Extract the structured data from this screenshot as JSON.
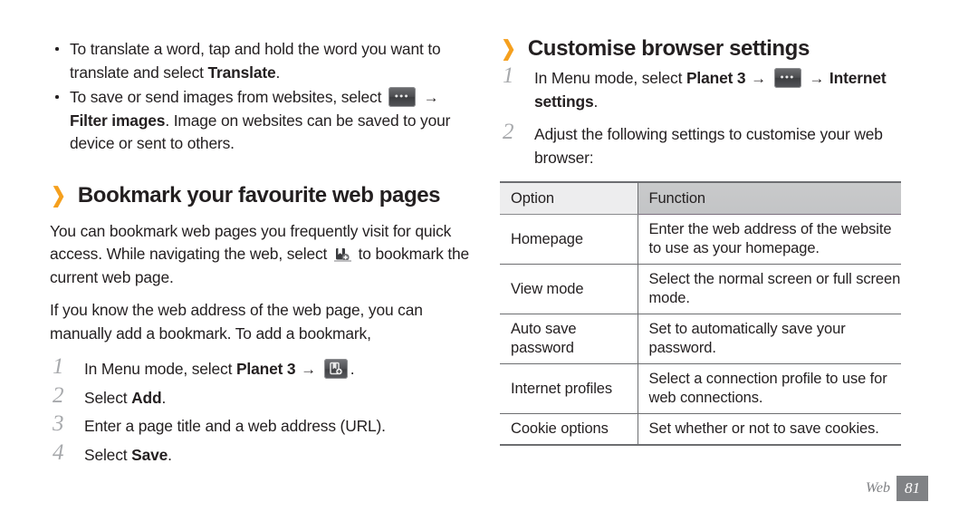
{
  "page": {
    "background": "#ffffff",
    "accent_orange": "#f5a01e",
    "text_color": "#231f20",
    "rule_color": "#6d6e71"
  },
  "left_column": {
    "bullets": [
      {
        "parts": [
          {
            "t": "To translate a word, tap and hold the word you want to translate and select ",
            "bold": false
          },
          {
            "t": "Translate",
            "bold": true
          },
          {
            "t": ".",
            "bold": false
          }
        ]
      },
      {
        "parts": [
          {
            "t": "To save or send images from websites, select ",
            "bold": false
          },
          {
            "icon": "more-options-key"
          },
          {
            "t": " ",
            "bold": false
          },
          {
            "arrow": "→"
          },
          {
            "t": " ",
            "bold": false
          },
          {
            "t": "Filter images",
            "bold": true
          },
          {
            "t": ". Image on websites can be saved to your device or sent to others.",
            "bold": false
          }
        ]
      }
    ],
    "heading": {
      "chevron": "❯",
      "text": "Bookmark your favourite web pages"
    },
    "paragraphs": [
      {
        "parts": [
          {
            "t": "You can bookmark web pages you frequently visit for quick access. While navigating the web, select ",
            "bold": false
          },
          {
            "icon": "add-bookmark-glyph"
          },
          {
            "t": " to bookmark the current web page.",
            "bold": false
          }
        ]
      },
      {
        "parts": [
          {
            "t": "If you know the web address of the web page, you can manually add a bookmark. To add a bookmark,",
            "bold": false
          }
        ]
      }
    ],
    "steps": [
      {
        "number": "1",
        "parts": [
          {
            "t": "In Menu mode, select ",
            "bold": false
          },
          {
            "t": "Planet 3",
            "bold": true
          },
          {
            "t": " ",
            "bold": false
          },
          {
            "arrow": "→"
          },
          {
            "t": " ",
            "bold": false
          },
          {
            "icon": "add-bookmark-key"
          },
          {
            "t": ".",
            "bold": false
          }
        ]
      },
      {
        "number": "2",
        "parts": [
          {
            "t": "Select ",
            "bold": false
          },
          {
            "t": "Add",
            "bold": true
          },
          {
            "t": ".",
            "bold": false
          }
        ]
      },
      {
        "number": "3",
        "parts": [
          {
            "t": "Enter a page title and a web address (URL).",
            "bold": false
          }
        ]
      },
      {
        "number": "4",
        "parts": [
          {
            "t": "Select ",
            "bold": false
          },
          {
            "t": "Save",
            "bold": true
          },
          {
            "t": ".",
            "bold": false
          }
        ]
      }
    ]
  },
  "right_column": {
    "heading": {
      "chevron": "❯",
      "text": "Customise browser settings"
    },
    "steps": [
      {
        "number": "1",
        "parts": [
          {
            "t": "In Menu mode, select ",
            "bold": false
          },
          {
            "t": "Planet 3",
            "bold": true
          },
          {
            "t": " ",
            "bold": false
          },
          {
            "arrow": "→"
          },
          {
            "t": " ",
            "bold": false
          },
          {
            "icon": "more-options-key"
          },
          {
            "t": " ",
            "bold": false
          },
          {
            "arrow": "→"
          },
          {
            "t": " ",
            "bold": false
          },
          {
            "t": "Internet settings",
            "bold": true
          },
          {
            "t": ".",
            "bold": false
          }
        ]
      },
      {
        "number": "2",
        "parts": [
          {
            "t": "Adjust the following settings to customise your web browser:",
            "bold": false
          }
        ]
      }
    ],
    "table": {
      "headers": [
        "Option",
        "Function"
      ],
      "rows": [
        {
          "option": "Homepage",
          "function": "Enter the web address of the website to use as your homepage."
        },
        {
          "option": "View mode",
          "function": "Select the normal screen or full screen mode."
        },
        {
          "option": "Auto save password",
          "function": "Set to automatically save your password."
        },
        {
          "option": "Internet profiles",
          "function": "Select a connection profile to use for web connections."
        },
        {
          "option": "Cookie options",
          "function": "Set whether or not to save cookies."
        }
      ]
    }
  },
  "footer": {
    "section_label": "Web",
    "page_number": "81"
  }
}
